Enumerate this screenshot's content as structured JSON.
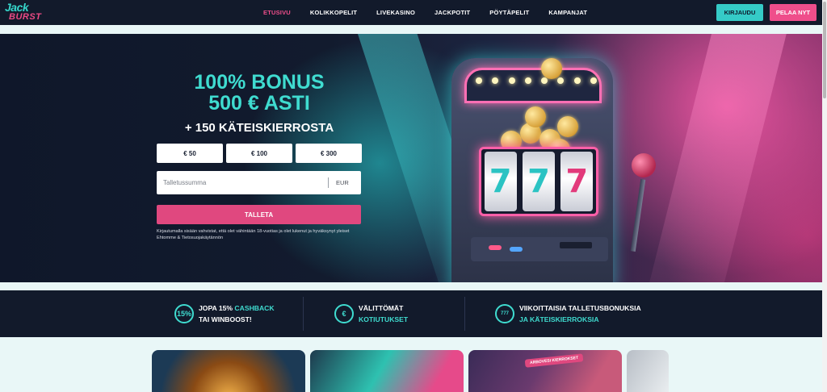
{
  "header": {
    "logo": {
      "line1": "Jack",
      "line2": "BURST"
    },
    "nav": [
      {
        "label": "ETUSIVU",
        "active": true
      },
      {
        "label": "KOLIKKOPELIT",
        "active": false
      },
      {
        "label": "LIVEKASINO",
        "active": false
      },
      {
        "label": "JACKPOTIT",
        "active": false
      },
      {
        "label": "PÖYTÄPELIT",
        "active": false
      },
      {
        "label": "KAMPANJAT",
        "active": false
      }
    ],
    "login_label": "KIRJAUDU",
    "play_label": "PELAA NYT"
  },
  "hero": {
    "title_line1": "100% BONUS",
    "title_line2": "500 € ASTI",
    "subtitle": "+ 150 KÄTEISKIERROSTA",
    "amounts": [
      "€ 50",
      "€ 100",
      "€ 300"
    ],
    "deposit_placeholder": "Talletussumma",
    "currency": "EUR",
    "deposit_button": "TALLETA",
    "terms": "Kirjautumalla sisään vahvistat, että olet vähintään 18-vuotias ja olet lukenut ja hyväksynyt yleiset Ehtomme & Tietosuojakäytännön",
    "reels": [
      "7",
      "7",
      "7"
    ]
  },
  "features": [
    {
      "icon": "15%",
      "line1_pre": "JOPA 15% ",
      "line1_hl": "CASHBACK",
      "line2_pre": "TAI WINBOOST!",
      "line2_hl": ""
    },
    {
      "icon": "€",
      "line1_pre": "VÄLITTÖMÄT",
      "line1_hl": "",
      "line2_pre": "",
      "line2_hl": "KOTIUTUKSET"
    },
    {
      "icon": "777",
      "line1_pre": "VIIKOITTAISIA TALLETUSBONUKSIA",
      "line1_hl": "",
      "line2_pre": "",
      "line2_hl": "JA KÄTEISKIERROKSIA"
    }
  ],
  "cards": {
    "badge": "ARBOVESI KIERROKSET"
  },
  "colors": {
    "brand_teal": "#3fdcd0",
    "brand_pink": "#e0487f",
    "header_bg": "#121a2b"
  }
}
